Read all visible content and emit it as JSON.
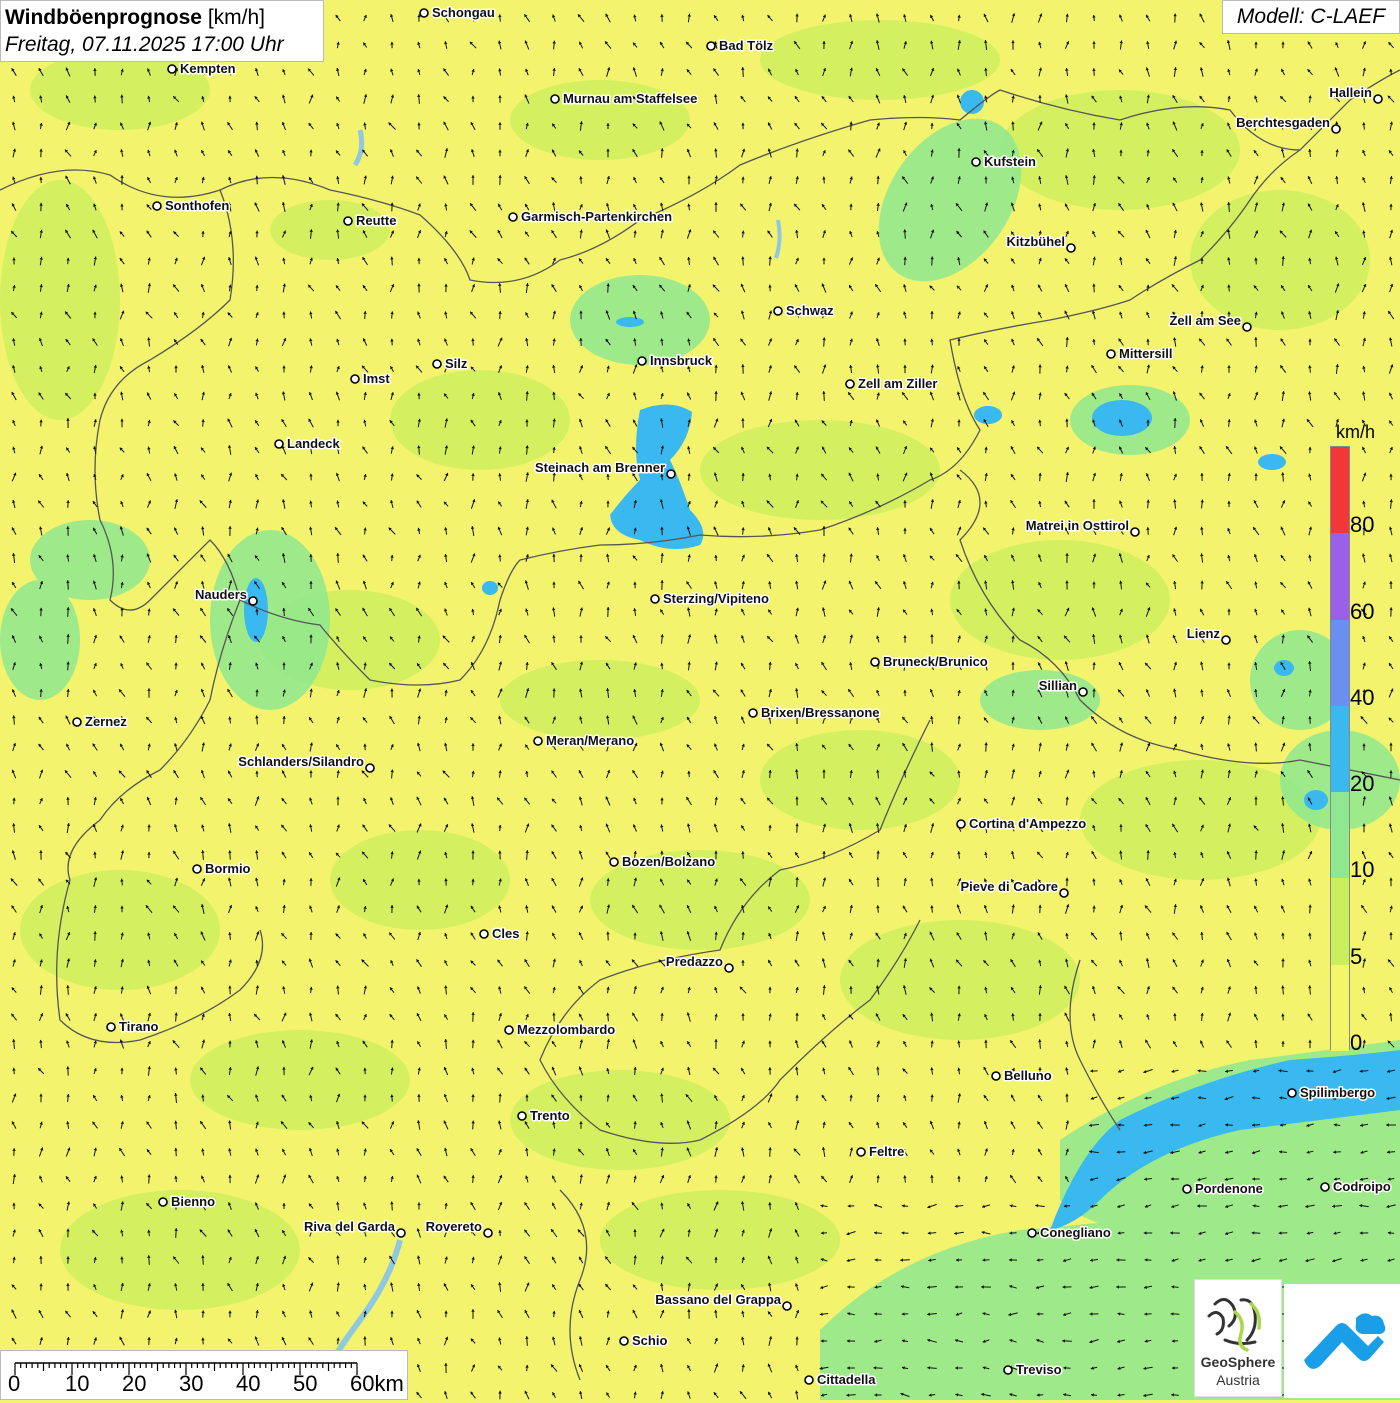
{
  "header": {
    "title_bold": "Windböenprognose",
    "title_unit": "[km/h]",
    "subtitle": "Freitag, 07.11.2025 17:00 Uhr",
    "model": "Modell: C-LAEF"
  },
  "legend": {
    "unit": "km/h",
    "ticks": [
      "0",
      "5",
      "10",
      "20",
      "40",
      "60",
      "80"
    ],
    "colors": [
      "#f5f56a",
      "#c9ef5c",
      "#8fe88f",
      "#3ab8f0",
      "#6a8ff0",
      "#9a60e8",
      "#f03838"
    ]
  },
  "scale_bar": {
    "labels": [
      "0",
      "10",
      "20",
      "30",
      "40",
      "50",
      "60km"
    ]
  },
  "logos": {
    "geosphere_line1": "GeoSphere",
    "geosphere_line2": "Austria"
  },
  "map_colors": {
    "calm": "#f3f36e",
    "light": "#c9ef5c",
    "moderate": "#8fe88f",
    "strong": "#3ab8f0",
    "border": "#555555",
    "arrow": "#111111"
  },
  "cities": [
    {
      "name": "Schongau"
    },
    {
      "name": "Kempten"
    },
    {
      "name": "Bad Tölz"
    },
    {
      "name": "Murnau am Staffelsee"
    },
    {
      "name": "Hallein"
    },
    {
      "name": "Berchtesgaden"
    },
    {
      "name": "Kufstein"
    },
    {
      "name": "Sonthofen"
    },
    {
      "name": "Reutte"
    },
    {
      "name": "Garmisch-Partenkirchen"
    },
    {
      "name": "Kitzbühel"
    },
    {
      "name": "Schwaz"
    },
    {
      "name": "Zell am See"
    },
    {
      "name": "Innsbruck"
    },
    {
      "name": "Mittersill"
    },
    {
      "name": "Imst"
    },
    {
      "name": "Silz"
    },
    {
      "name": "Zell am Ziller"
    },
    {
      "name": "Landeck"
    },
    {
      "name": "Steinach am Brenner"
    },
    {
      "name": "Matrei in Osttirol"
    },
    {
      "name": "Nauders"
    },
    {
      "name": "Sterzing/Vipiteno"
    },
    {
      "name": "Lienz"
    },
    {
      "name": "Bruneck/Brunico"
    },
    {
      "name": "Sillian"
    },
    {
      "name": "Zernez"
    },
    {
      "name": "Brixen/Bressanone"
    },
    {
      "name": "Meran/Merano"
    },
    {
      "name": "Schlanders/Silandro"
    },
    {
      "name": "Cortina d'Ampezzo"
    },
    {
      "name": "Bozen/Bolzano"
    },
    {
      "name": "Bormio"
    },
    {
      "name": "Pieve di Cadore"
    },
    {
      "name": "Cles"
    },
    {
      "name": "Predazzo"
    },
    {
      "name": "Tirano"
    },
    {
      "name": "Mezzolombardo"
    },
    {
      "name": "Belluno"
    },
    {
      "name": "Spilimbergo"
    },
    {
      "name": "Trento"
    },
    {
      "name": "Feltre"
    },
    {
      "name": "Bienno"
    },
    {
      "name": "Pordenone"
    },
    {
      "name": "Codroipo"
    },
    {
      "name": "Riva del Garda"
    },
    {
      "name": "Rovereto"
    },
    {
      "name": "Conegliano"
    },
    {
      "name": "Bassano del Grappa"
    },
    {
      "name": "Schio"
    },
    {
      "name": "Treviso"
    },
    {
      "name": "Cittadella"
    }
  ]
}
